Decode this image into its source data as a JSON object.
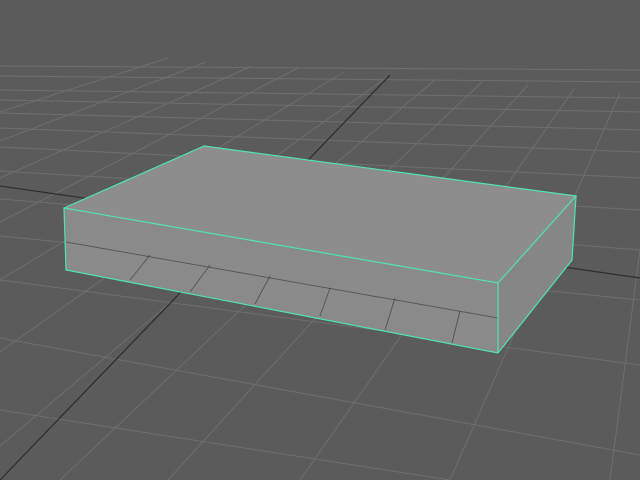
{
  "viewport": {
    "background_color": "#5b5b5b",
    "grid_line_color": "#6e6e6e",
    "grid_axis_color": "#2f2f2f",
    "selection_color": "#4ee3b6"
  },
  "scene": {
    "object_type": "box",
    "selected": true,
    "face_colors": {
      "top": "#8d8d8d",
      "front": "#8a8a8a",
      "right": "#868686"
    }
  }
}
